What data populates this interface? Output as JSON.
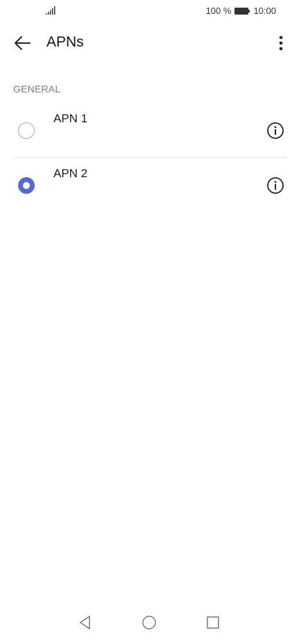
{
  "status_bar": {
    "battery_percent": "100 %",
    "time": "10:00",
    "icons": [
      "signal-icon",
      "battery-icon"
    ]
  },
  "app_bar": {
    "title": "APNs",
    "icons": [
      "back-arrow-icon",
      "more-vert-icon"
    ]
  },
  "section": {
    "header": "GENERAL"
  },
  "apns": [
    {
      "name": "APN 1",
      "selected": false
    },
    {
      "name": "APN 2",
      "selected": true
    }
  ],
  "colors": {
    "accent": "#5469d4",
    "text": "#1a1a1a",
    "section_header": "#7a7a7a",
    "divider": "#e4e4e4"
  },
  "nav_bar": {
    "icons": [
      "nav-back-icon",
      "nav-home-icon",
      "nav-recents-icon"
    ]
  }
}
